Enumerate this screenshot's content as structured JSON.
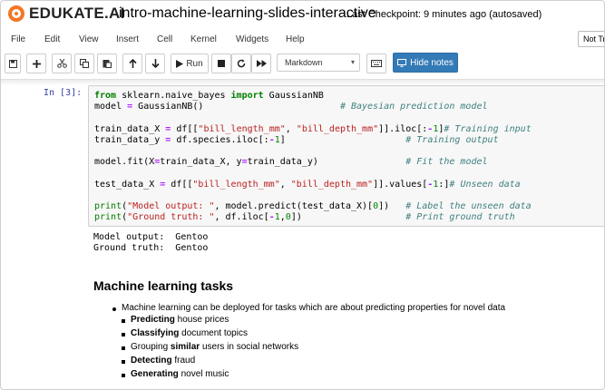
{
  "header": {
    "logo_text": "EDUKATE.AI",
    "notebook_title": "intro-machine-learning-slides-interactive",
    "checkpoint": "Last Checkpoint: 9 minutes ago  (autosaved)"
  },
  "menu": {
    "items": [
      "File",
      "Edit",
      "View",
      "Insert",
      "Cell",
      "Kernel",
      "Widgets",
      "Help"
    ],
    "kernel_indicator": "Not Tr"
  },
  "toolbar": {
    "run_label": "Run",
    "cell_type": "Markdown",
    "hide_notes_label": "Hide notes"
  },
  "code_cell": {
    "prompt": "In [3]:",
    "lines": [
      "from sklearn.naive_bayes import GaussianNB",
      "model = GaussianNB()                          # Bayesian prediction model",
      "",
      "train_data_X = df[[\"bill_length_mm\", \"bill_depth_mm\"]].iloc[:-1]# Training input",
      "train_data_y = df.species.iloc[:-1]                       # Training output",
      "",
      "model.fit(X=train_data_X, y=train_data_y)                 # Fit the model",
      "",
      "test_data_X = df[[\"bill_length_mm\", \"bill_depth_mm\"]].values[-1:]# Unseen data",
      "",
      "print(\"Model output: \", model.predict(test_data_X)[0])    # Label the unseen data",
      "print(\"Ground truth: \", df.iloc[-1,0])                    # Print ground truth"
    ]
  },
  "output": {
    "lines": [
      "Model output:  Gentoo",
      "Ground truth:  Gentoo"
    ]
  },
  "markdown": {
    "heading": "Machine learning tasks",
    "intro": "Machine learning can be deployed for tasks which are about predicting properties for novel data",
    "tasks": [
      {
        "bold": "Predicting",
        "rest": " house prices"
      },
      {
        "bold": "Classifying",
        "rest": " document topics"
      },
      {
        "pre": "Grouping ",
        "bold": "similar",
        "rest": " users in social networks"
      },
      {
        "bold": "Detecting",
        "rest": " fraud"
      },
      {
        "bold": "Generating",
        "rest": " novel music"
      }
    ]
  },
  "colors": {
    "accent": "#337ab7",
    "logo_orange": "#f37726",
    "prompt_blue": "#303f9f"
  },
  "icons": [
    "save-icon",
    "plus-icon",
    "scissors-icon",
    "copy-icon",
    "paste-icon",
    "arrow-up-icon",
    "arrow-down-icon",
    "play-icon",
    "stop-icon",
    "restart-icon",
    "fast-forward-icon",
    "keyboard-icon",
    "presentation-icon"
  ]
}
